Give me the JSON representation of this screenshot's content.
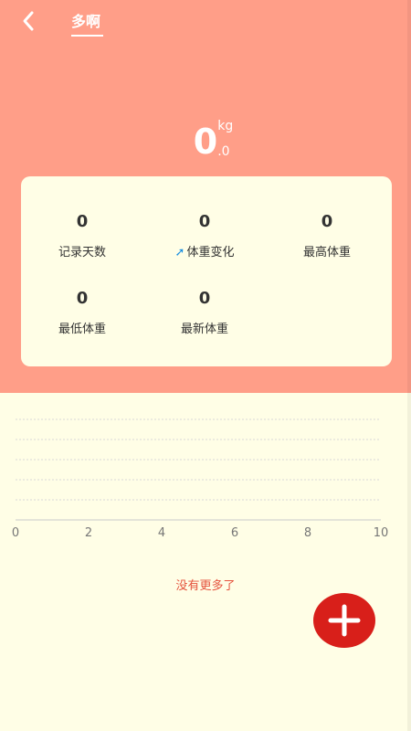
{
  "header": {
    "back_icon": "chevron-left-icon",
    "tab_title": "多啊"
  },
  "weight": {
    "integer": "0",
    "unit": "kg",
    "decimal": ".0"
  },
  "stats": [
    {
      "value": "0",
      "label": "记录天数"
    },
    {
      "value": "0",
      "label": "体重变化",
      "icon": "arrow-up-icon"
    },
    {
      "value": "0",
      "label": "最高体重"
    },
    {
      "value": "0",
      "label": "最低体重"
    },
    {
      "value": "0",
      "label": "最新体重"
    }
  ],
  "chart_data": {
    "type": "line",
    "x_ticks": [
      "0",
      "2",
      "4",
      "6",
      "8",
      "10"
    ],
    "xlim": [
      0,
      10
    ],
    "series": [],
    "grid": true
  },
  "empty_text": "没有更多了",
  "fab": {
    "icon": "plus-icon",
    "color": "#d81f1a"
  },
  "colors": {
    "header_bg": "#ff9e88",
    "page_bg": "#fffee6",
    "accent": "#e5533d",
    "change_icon": "#1a8fe0"
  }
}
